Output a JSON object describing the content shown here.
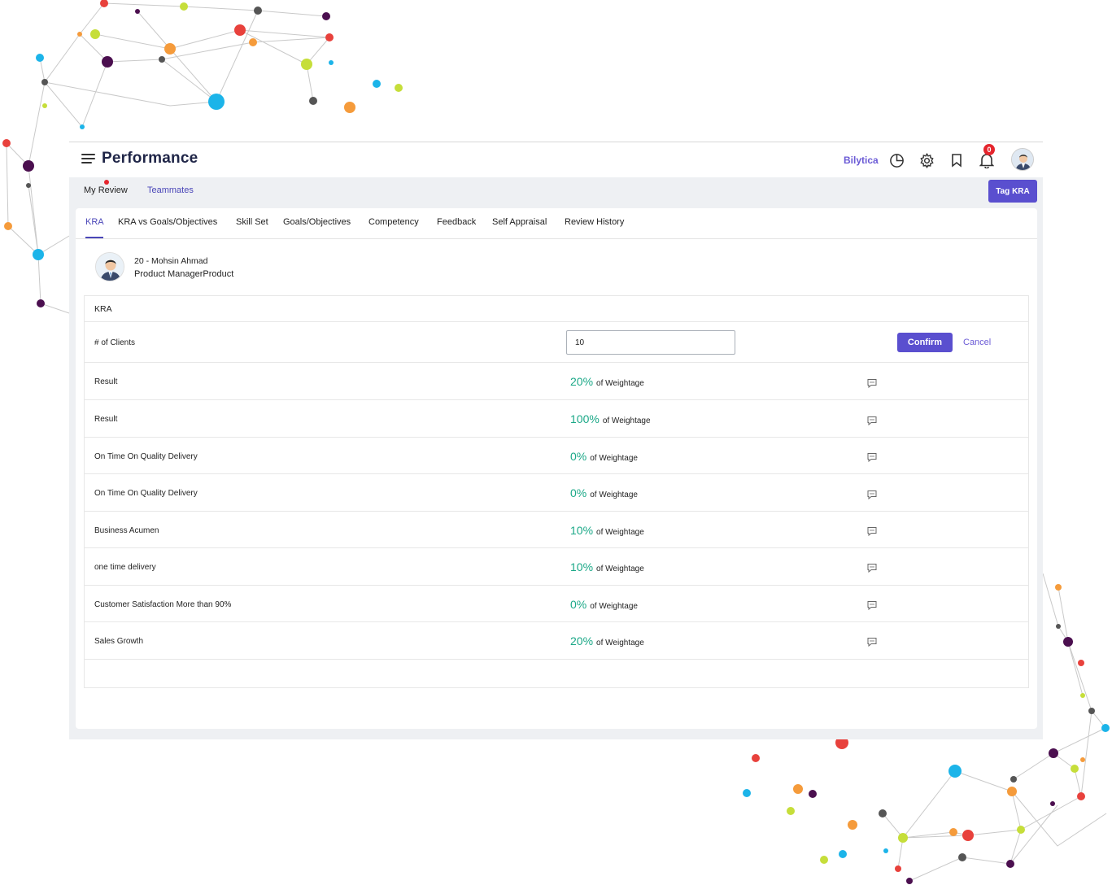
{
  "header": {
    "title": "Performance",
    "brand": "Bilytica",
    "icons": [
      "menu-icon",
      "pie-chart-icon",
      "gear-icon",
      "bookmark-icon",
      "bell-icon",
      "avatar"
    ],
    "notifications_count": "0"
  },
  "subnav": {
    "items": [
      "My Review",
      "Teammates"
    ],
    "tag_button": "Tag KRA"
  },
  "tabs": [
    "KRA",
    "KRA vs Goals/Objectives",
    "Skill Set",
    "Goals/Objectives",
    "Competency",
    "Feedback",
    "Self Appraisal",
    "Review History"
  ],
  "employee": {
    "name": "20 - Mohsin Ahmad",
    "role": "Product ManagerProduct"
  },
  "kra": {
    "header": "KRA",
    "edit_row": {
      "label": "# of Clients",
      "value": "10",
      "confirm": "Confirm",
      "cancel": "Cancel"
    },
    "weightage_suffix": "of Weightage",
    "rows": [
      {
        "label": "Result",
        "pct": "20%"
      },
      {
        "label": "Result",
        "pct": "100%"
      },
      {
        "label": "On Time On Quality Delivery",
        "pct": "0%"
      },
      {
        "label": "On Time On Quality Delivery",
        "pct": "0%"
      },
      {
        "label": "Business Acumen",
        "pct": "10%"
      },
      {
        "label": "one time delivery",
        "pct": "10%"
      },
      {
        "label": "Customer Satisfaction More than 90%",
        "pct": "0%"
      },
      {
        "label": "Sales Growth",
        "pct": "20%"
      }
    ]
  },
  "colors": {
    "accent": "#5a4fcf",
    "percent": "#1aa887",
    "title": "#1f2547",
    "badge": "#e5252d"
  }
}
